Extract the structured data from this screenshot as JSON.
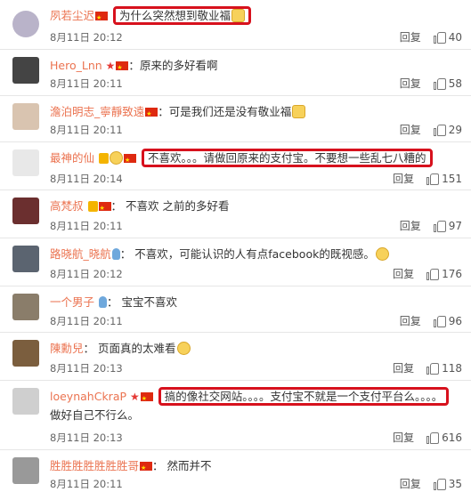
{
  "labels": {
    "reply": "回复"
  },
  "comments": [
    {
      "user": "夙若尘迟",
      "text": "为什么突然想到敬业福",
      "date": "8月11日 20:12",
      "likes": "40"
    },
    {
      "user": "Hero_Lnn",
      "text": "原来的多好看啊",
      "date": "8月11日 20:11",
      "likes": "58"
    },
    {
      "user": "澹泊明志_寧靜致遠",
      "text": "可是我们还是没有敬业福",
      "date": "8月11日 20:11",
      "likes": "29"
    },
    {
      "user": "最神的仙",
      "text": "不喜欢。。。请做回原来的支付宝。不要想一些乱七八糟的",
      "date": "8月11日 20:14",
      "likes": "151"
    },
    {
      "user": "高梵叔",
      "text": "不喜欢 之前的多好看",
      "date": "8月11日 20:11",
      "likes": "97"
    },
    {
      "user": "路晓航_晓航",
      "text": "不喜欢，可能认识的人有点facebook的既视感。",
      "date": "8月11日 20:12",
      "likes": "176"
    },
    {
      "user": "一个男子",
      "text": "宝宝不喜欢",
      "date": "8月11日 20:11",
      "likes": "96"
    },
    {
      "user": "陳勳兒",
      "text": "页面真的太难看",
      "date": "8月11日 20:13",
      "likes": "118"
    },
    {
      "user": "loeynahCkraP",
      "text": "搞的像社交网站。。。。支付宝不就是一个支付平台么。。。。",
      "text2": "做好自己不行么。",
      "date": "8月11日 20:13",
      "likes": "616"
    },
    {
      "user": "胜胜胜胜胜胜胜哥",
      "text": "然而并不",
      "date": "8月11日 20:11",
      "likes": "35"
    }
  ]
}
